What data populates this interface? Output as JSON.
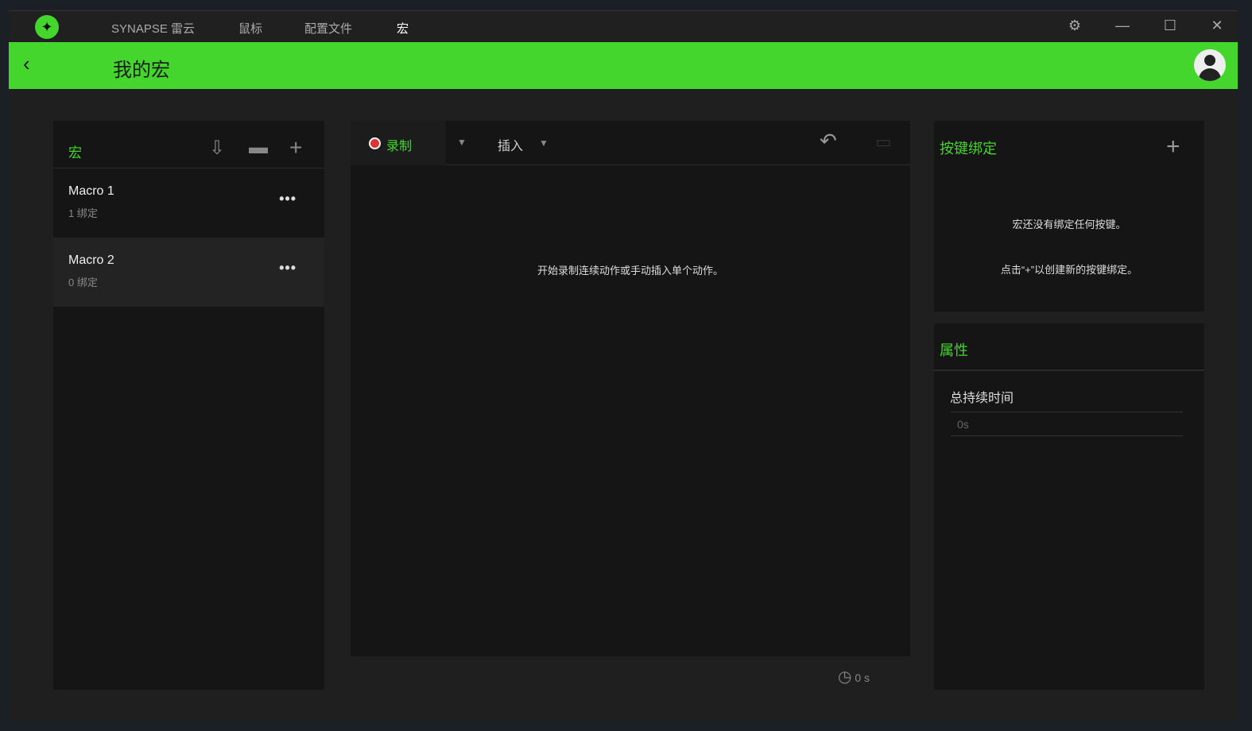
{
  "titlebar": {
    "nav": [
      "SYNAPSE 雷云",
      "鼠标",
      "配置文件",
      "宏"
    ],
    "active": "宏"
  },
  "header": {
    "title": "我的宏"
  },
  "macros": {
    "title": "宏",
    "items": [
      {
        "name": "Macro 1",
        "bindings": "1 绑定"
      },
      {
        "name": "Macro 2",
        "bindings": "0 绑定"
      }
    ]
  },
  "editor": {
    "record": "录制",
    "insert": "插入",
    "empty": "开始录制连续动作或手动插入单个动作。",
    "duration": "0 s"
  },
  "bindings": {
    "title": "按键绑定",
    "line1": "宏还没有绑定任何按键。",
    "line2": "点击“+”以创建新的按键绑定。"
  },
  "properties": {
    "title": "属性",
    "label": "总持续时间",
    "value": "0s"
  },
  "colors": {
    "accent": "#44d62c"
  }
}
